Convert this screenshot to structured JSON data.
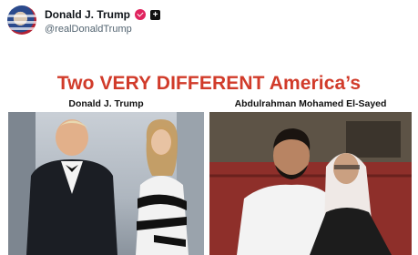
{
  "author": {
    "display_name": "Donald J. Trump",
    "handle": "@realDonaldTrump",
    "avatar_icon": "flag-avatar",
    "verified_icon": "verified-badge-icon",
    "follow_icon": "plus-icon"
  },
  "post": {
    "headline": "Two VERY DIFFERENT America’s",
    "left_label": "Donald J. Trump",
    "right_label": "Abdulrahman Mohamed El-Sayed"
  },
  "colors": {
    "headline": "#d13b2a",
    "badge": "#e0245e"
  }
}
